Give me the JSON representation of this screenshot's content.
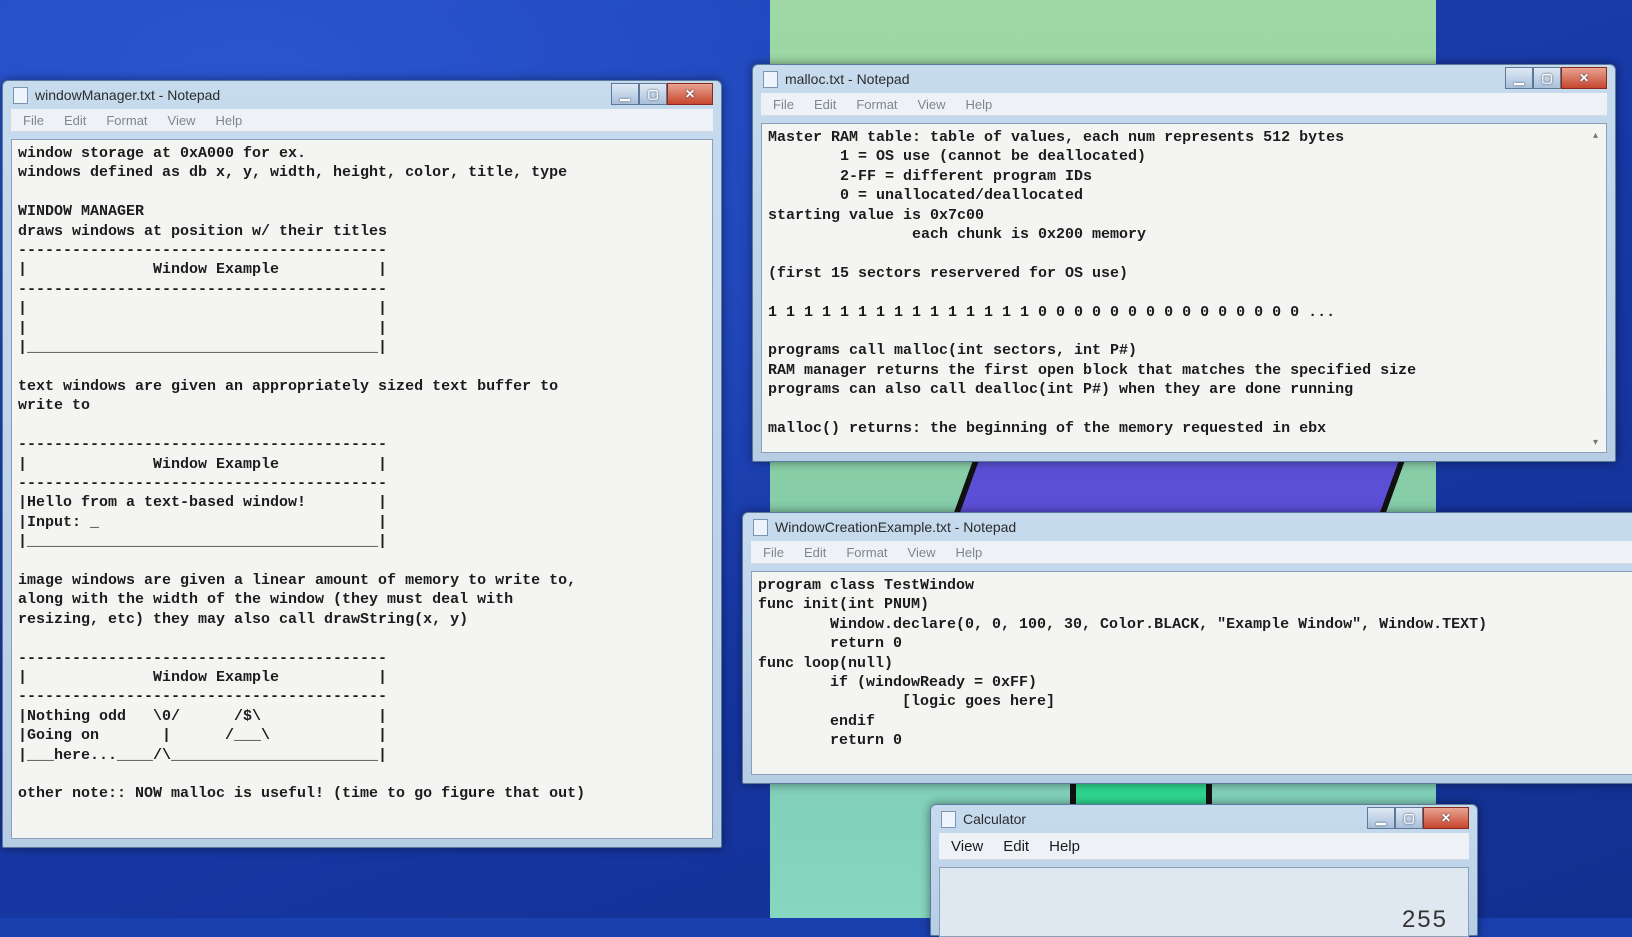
{
  "menu": {
    "file": "File",
    "edit": "Edit",
    "format": "Format",
    "view": "View",
    "help": "Help"
  },
  "windows": {
    "window_manager": {
      "title": "windowManager.txt - Notepad",
      "text": "window storage at 0xA000 for ex.\nwindows defined as db x, y, width, height, color, title, type\n\nWINDOW MANAGER\ndraws windows at position w/ their titles\n-----------------------------------------\n|              Window Example           |\n-----------------------------------------\n|                                       |\n|                                       |\n|_______________________________________|\n\ntext windows are given an appropriately sized text buffer to\nwrite to\n\n-----------------------------------------\n|              Window Example           |\n-----------------------------------------\n|Hello from a text-based window!        |\n|Input: _                               |\n|_______________________________________|\n\nimage windows are given a linear amount of memory to write to,\nalong with the width of the window (they must deal with\nresizing, etc) they may also call drawString(x, y)\n\n-----------------------------------------\n|              Window Example           |\n-----------------------------------------\n|Nothing odd   \\0/      /$\\             |\n|Going on       |      /___\\            |\n|___here...____/\\_______________________|\n\nother note:: NOW malloc is useful! (time to go figure that out)"
    },
    "malloc": {
      "title": "malloc.txt - Notepad",
      "text": "Master RAM table: table of values, each num represents 512 bytes\n        1 = OS use (cannot be deallocated)\n        2-FF = different program IDs\n        0 = unallocated/deallocated\nstarting value is 0x7c00\n                each chunk is 0x200 memory\n\n(first 15 sectors reservered for OS use)\n\n1 1 1 1 1 1 1 1 1 1 1 1 1 1 1 0 0 0 0 0 0 0 0 0 0 0 0 0 0 0 ...\n\nprograms call malloc(int sectors, int P#)\nRAM manager returns the first open block that matches the specified size\nprograms can also call dealloc(int P#) when they are done running\n\nmalloc() returns: the beginning of the memory requested in ebx"
    },
    "window_creation": {
      "title": "WindowCreationExample.txt - Notepad",
      "text": "program class TestWindow\nfunc init(int PNUM)\n        Window.declare(0, 0, 100, 30, Color.BLACK, \"Example Window\", Window.TEXT)\n        return 0\nfunc loop(null)\n        if (windowReady = 0xFF)\n                [logic goes here]\n        endif\n        return 0"
    },
    "calculator": {
      "title": "Calculator",
      "menu": {
        "view": "View",
        "edit": "Edit",
        "help": "Help"
      },
      "display": "255"
    }
  }
}
